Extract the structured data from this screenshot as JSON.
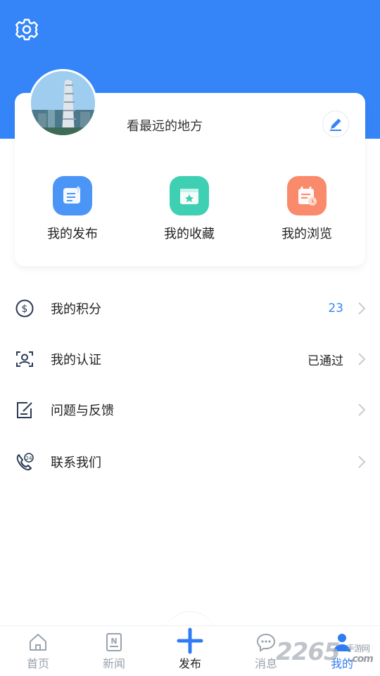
{
  "header": {
    "settings_icon": "gear-icon",
    "background_color": "#3585f9"
  },
  "profile": {
    "nickname": "看最远的地方",
    "avatar_icon": "avatar-city-photo",
    "edit_icon": "pencil-icon"
  },
  "shortcuts": [
    {
      "label": "我的发布",
      "icon": "document-upload-icon",
      "color": "#4b95f6"
    },
    {
      "label": "我的收藏",
      "icon": "star-folder-icon",
      "color": "#3fcfb3"
    },
    {
      "label": "我的浏览",
      "icon": "history-calendar-icon",
      "color": "#fa8a6c"
    }
  ],
  "menu": [
    {
      "label": "我的积分",
      "value": "23",
      "icon": "coin-icon",
      "value_color": "#3585f9"
    },
    {
      "label": "我的认证",
      "value": "已通过",
      "icon": "id-verify-icon",
      "value_color": "#222222"
    },
    {
      "label": "问题与反馈",
      "value": "",
      "icon": "feedback-edit-icon"
    },
    {
      "label": "联系我们",
      "value": "",
      "icon": "phone-24-icon"
    }
  ],
  "tabbar": {
    "items": [
      {
        "label": "首页",
        "icon": "home-icon"
      },
      {
        "label": "新闻",
        "icon": "news-icon"
      },
      {
        "label": "发布",
        "icon": "plus-icon"
      },
      {
        "label": "消息",
        "icon": "chat-bubble-icon"
      },
      {
        "label": "我的",
        "icon": "user-icon"
      }
    ],
    "active": "我的"
  },
  "watermark": {
    "text": "2265",
    "suffix": ".com",
    "sub": "手游网"
  }
}
